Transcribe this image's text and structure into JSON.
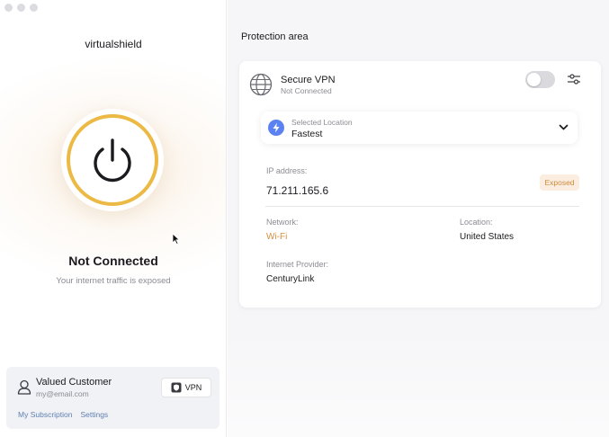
{
  "app": {
    "title": "virtualshield"
  },
  "status": {
    "title": "Not Connected",
    "subtitle": "Your internet traffic is exposed"
  },
  "account": {
    "name": "Valued Customer",
    "email": "my@email.com",
    "vpn_button_label": "VPN",
    "links": [
      "My Subscription",
      "Settings"
    ]
  },
  "protection": {
    "title": "Protection area",
    "vpn_title": "Secure VPN",
    "vpn_status": "Not Connected",
    "toggle_on": false,
    "location_label": "Selected Location",
    "location_value": "Fastest",
    "ip_label": "IP address:",
    "ip_value": "71.211.165.6",
    "ip_badge": "Exposed",
    "network_label": "Network:",
    "network_value": "Wi-Fi",
    "loc_label": "Location:",
    "loc_value": "United States",
    "provider_label": "Internet Provider:",
    "provider_value": "CenturyLink"
  },
  "colors": {
    "ring": "#ecb944",
    "accent_blue": "#5b82f0",
    "exposed_text": "#cf8a3f",
    "link": "#5f7fb0"
  },
  "icons": [
    "power-icon",
    "user-icon",
    "shield-icon",
    "globe-icon",
    "sliders-icon",
    "bolt-icon",
    "chevron-down-icon"
  ]
}
